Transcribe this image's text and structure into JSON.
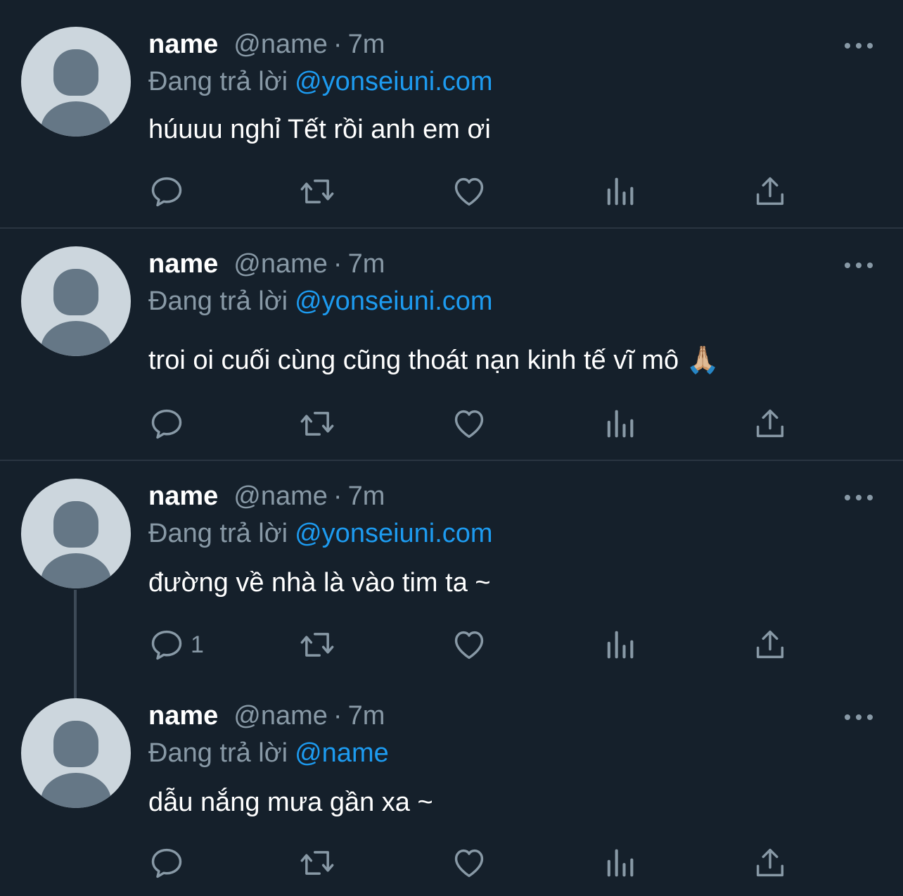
{
  "colors": {
    "background": "#15202b",
    "divider": "#2a3541",
    "text_primary": "#ffffff",
    "text_secondary": "#8899a6",
    "link": "#1d9bf0",
    "avatar_bg": "#ccd6dd",
    "avatar_fg": "#657786"
  },
  "icons": [
    "more-icon",
    "reply-icon",
    "retweet-icon",
    "like-icon",
    "views-icon",
    "share-icon"
  ],
  "tweets": [
    {
      "name": "name",
      "handle": "@name",
      "separator": "·",
      "time": "7m",
      "replying_label": "Đang trả lời",
      "replying_to": "@yonseiuni.com",
      "text": "húuuu nghỉ Tết rồi anh em ơi",
      "reply_count": ""
    },
    {
      "name": "name",
      "handle": "@name",
      "separator": "·",
      "time": "7m",
      "replying_label": "Đang trả lời",
      "replying_to": "@yonseiuni.com",
      "text": "troi oi cuối cùng cũng thoát nạn kinh tế vĩ mô 🙏🏼",
      "reply_count": ""
    },
    {
      "name": "name",
      "handle": "@name",
      "separator": "·",
      "time": "7m",
      "replying_label": "Đang trả lời",
      "replying_to": "@yonseiuni.com",
      "text": "đường về nhà là vào tim ta ~",
      "reply_count": "1"
    },
    {
      "name": "name",
      "handle": "@name",
      "separator": "·",
      "time": "7m",
      "replying_label": "Đang trả lời",
      "replying_to": "@name",
      "text": "dẫu nắng mưa gần xa ~",
      "reply_count": ""
    }
  ]
}
